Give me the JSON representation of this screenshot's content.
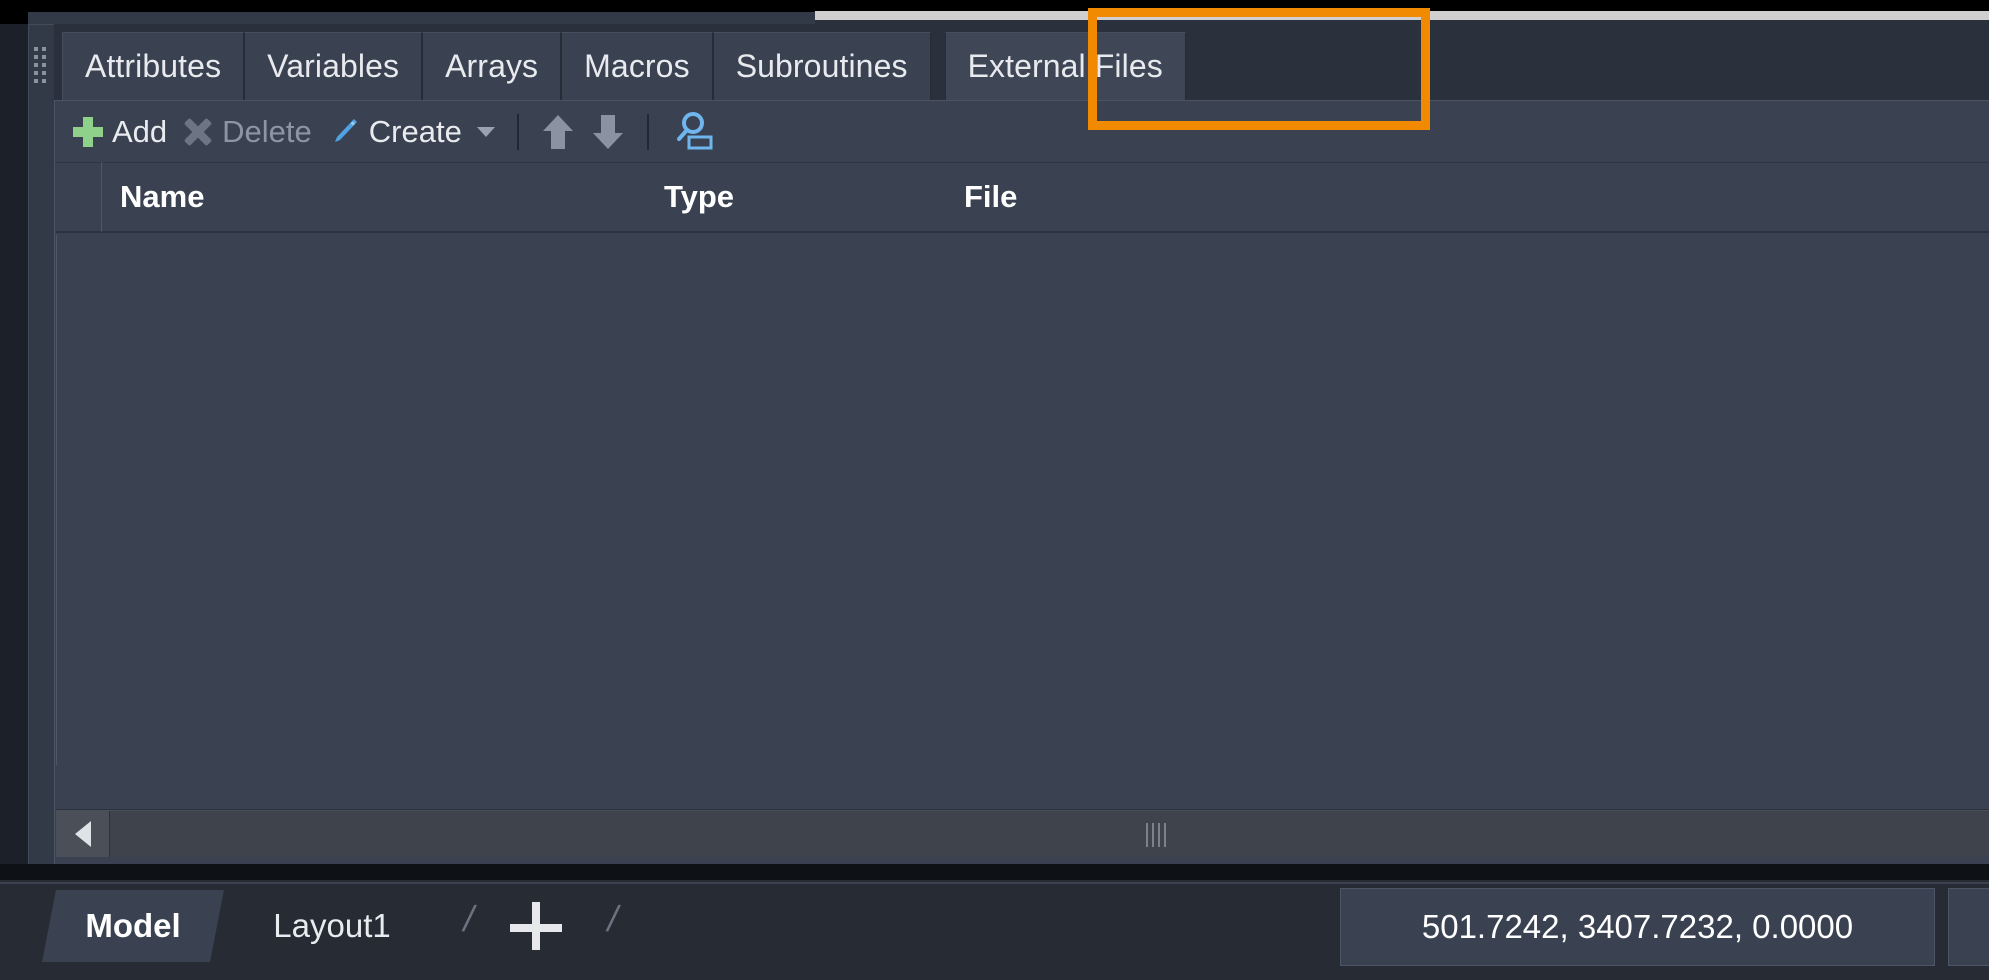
{
  "window": {
    "accent_highlight_color": "#f18a00",
    "panel_background": "#3a4252",
    "tabstrip_background": "#2b313c"
  },
  "tabs": {
    "items": [
      {
        "label": "Attributes",
        "selected": false
      },
      {
        "label": "Variables",
        "selected": false
      },
      {
        "label": "Arrays",
        "selected": false
      },
      {
        "label": "Macros",
        "selected": false
      },
      {
        "label": "Subroutines",
        "selected": false
      },
      {
        "label": "External Files",
        "selected": true
      }
    ],
    "highlighted": "External Files"
  },
  "toolbar": {
    "add_label": "Add",
    "add_icon": "plus-icon",
    "delete_label": "Delete",
    "delete_icon": "cross-icon",
    "delete_enabled": false,
    "create_label": "Create",
    "create_icon": "pencil-icon",
    "create_has_dropdown": true,
    "move_up_icon": "arrow-up-icon",
    "move_down_icon": "arrow-down-icon",
    "find_icon": "magnifier-select-icon"
  },
  "table": {
    "columns": [
      {
        "key": "name",
        "label": "Name"
      },
      {
        "key": "type",
        "label": "Type"
      },
      {
        "key": "file",
        "label": "File"
      }
    ],
    "rows": []
  },
  "scrollbar": {
    "left_arrow_icon": "arrow-left-icon",
    "grip_icon": "grip-lines-icon"
  },
  "layout_tabs": {
    "items": [
      {
        "label": "Model",
        "active": true
      },
      {
        "label": "Layout1",
        "active": false
      }
    ],
    "separator": "/",
    "add_label": "+",
    "add_icon": "plus-icon"
  },
  "status": {
    "coordinates": "501.7242, 3407.7232, 0.0000"
  }
}
